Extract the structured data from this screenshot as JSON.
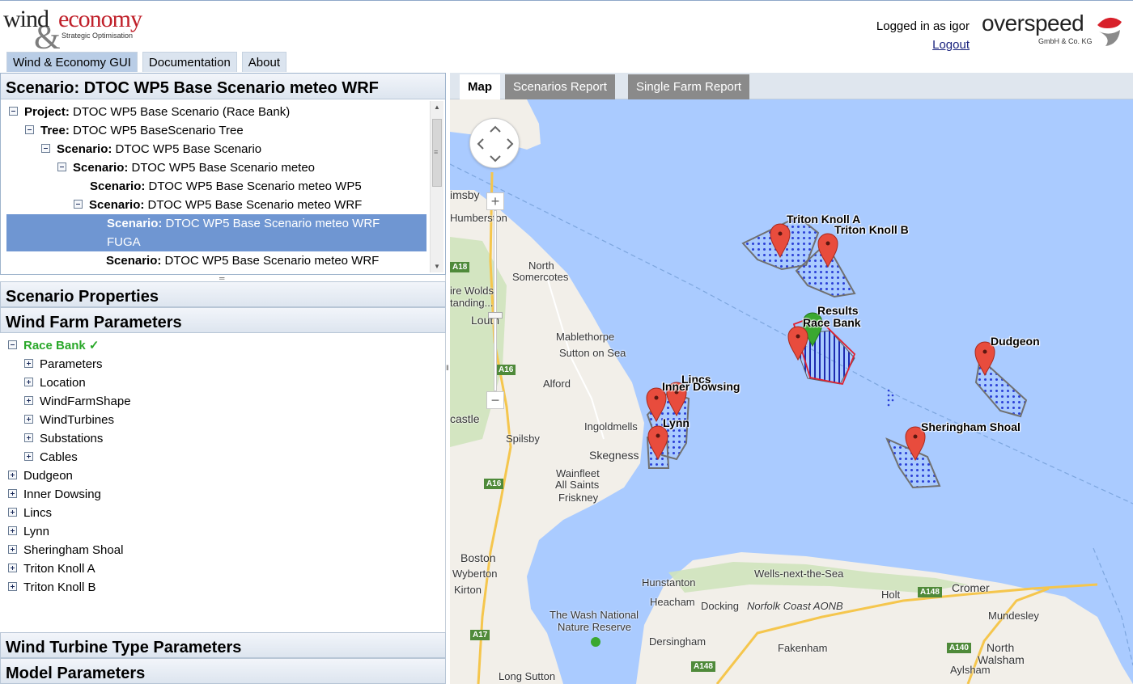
{
  "header": {
    "logo_left": {
      "word1": "wind",
      "word2": "economy",
      "amp": "&",
      "tagline": "Strategic Optimisation"
    },
    "login_text": "Logged in as igor",
    "logout_label": "Logout",
    "logo_right": {
      "name": "overspeed",
      "sub": "GmbH & Co. KG"
    },
    "nav": [
      {
        "label": "Wind & Economy GUI"
      },
      {
        "label": "Documentation"
      },
      {
        "label": "About"
      }
    ]
  },
  "scenario_tree": {
    "title": "Scenario: DTOC WP5 Base Scenario meteo WRF",
    "rows": [
      {
        "key": "Project:",
        "value": "DTOC WP5 Base Scenario (Race Bank)"
      },
      {
        "key": "Tree:",
        "value": "DTOC WP5 BaseScenario Tree"
      },
      {
        "key": "Scenario:",
        "value": "DTOC WP5 Base Scenario"
      },
      {
        "key": "Scenario:",
        "value": "DTOC WP5 Base Scenario meteo"
      },
      {
        "key": "Scenario:",
        "value": "DTOC WP5 Base Scenario meteo WP5"
      },
      {
        "key": "Scenario:",
        "value": "DTOC WP5 Base Scenario meteo WRF"
      },
      {
        "key": "Scenario:",
        "value": "DTOC WP5 Base Scenario meteo WRF",
        "value2": "FUGA"
      },
      {
        "key": "Scenario:",
        "value": "DTOC WP5 Base Scenario meteo WRF"
      }
    ]
  },
  "sections": {
    "scenario_properties": "Scenario Properties",
    "wind_farm_parameters": "Wind Farm Parameters",
    "wind_turbine_type_parameters": "Wind Turbine Type Parameters",
    "model_parameters": "Model Parameters"
  },
  "wind_farms": {
    "active": {
      "name": "Race Bank",
      "check": "✓"
    },
    "children": [
      "Parameters",
      "Location",
      "WindFarmShape",
      "WindTurbines",
      "Substations",
      "Cables"
    ],
    "others": [
      "Dudgeon",
      "Inner Dowsing",
      "Lincs",
      "Lynn",
      "Sheringham Shoal",
      "Triton Knoll A",
      "Triton Knoll B"
    ]
  },
  "tabs": [
    {
      "label": "Map"
    },
    {
      "label": "Scenarios Report"
    },
    {
      "label": "Single Farm Report"
    }
  ],
  "map": {
    "places": [
      "imsby",
      "Humberston",
      "North",
      "Somercotes",
      "ire Wolds",
      "tanding...",
      "Louth",
      "Mablethorpe",
      "Sutton on Sea",
      "Alford",
      "Ingoldmells",
      "castle",
      "Spilsby",
      "Skegness",
      "Wainfleet",
      "All Saints",
      "Friskney",
      "Boston",
      "Wyberton",
      "Kirton",
      "The Wash National",
      "Nature Reserve",
      "Hunstanton",
      "Heacham",
      "Docking",
      "Norfolk Coast AONB",
      "Wells-next-the-Sea",
      "Holt",
      "Cromer",
      "Mundesley",
      "Dersingham",
      "Fakenham",
      "North",
      "Walsham",
      "Aylsham",
      "Long Sutton"
    ],
    "roads": [
      "A18",
      "A16",
      "A16",
      "A17",
      "A148",
      "A148",
      "A140"
    ],
    "farm_labels": {
      "triton_a": "Triton Knoll A",
      "triton_b": "Triton Knoll B",
      "results": "Results",
      "race_bank": "Race Bank",
      "dudgeon": "Dudgeon",
      "lincs": "Lincs",
      "inner_dowsing": "Inner Dowsing",
      "lynn": "Lynn",
      "sheringham": "Sheringham Shoal"
    },
    "colors": {
      "water": "#aacbff",
      "land": "#f2efe9",
      "pin": "#e84c3d",
      "pin_result": "#3aa830",
      "turbine": "#2b3fd6"
    }
  }
}
